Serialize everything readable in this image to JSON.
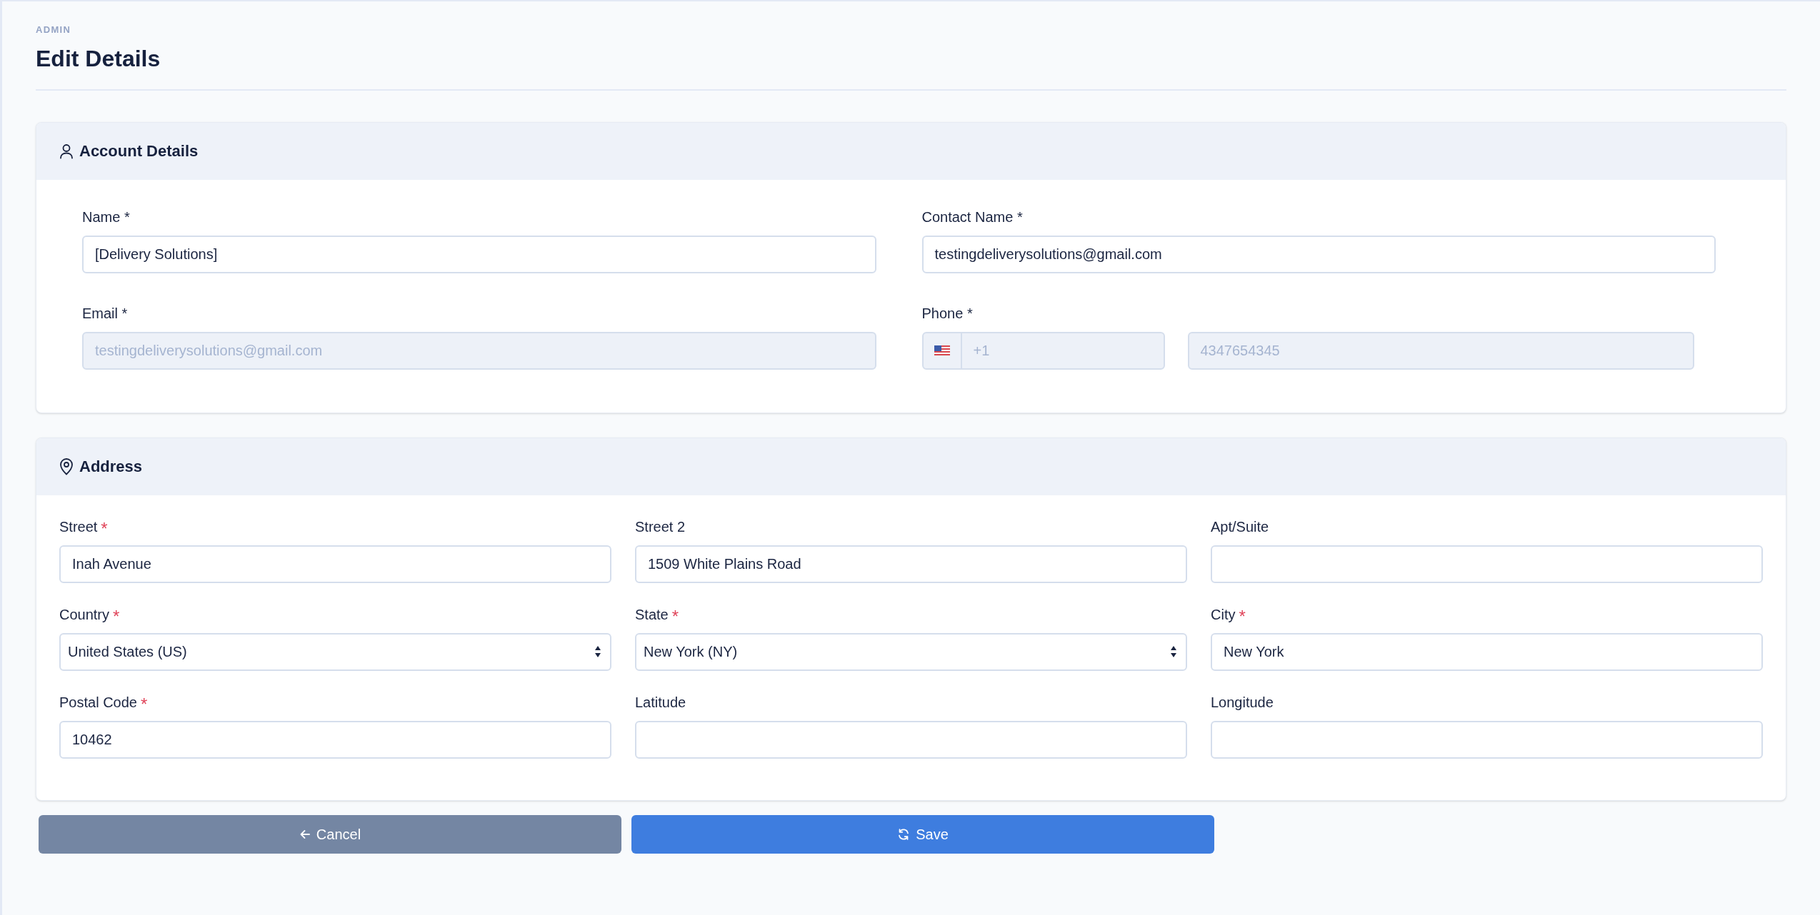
{
  "breadcrumb": "ADMIN",
  "title": "Edit Details",
  "sections": [
    {
      "title": "Account Details",
      "kind": "account",
      "fields": [
        {
          "kind": "text",
          "label": "Name *",
          "value": "[Delivery Solutions]",
          "disabled": false
        },
        {
          "kind": "text",
          "label": "Contact Name *",
          "value": "testingdeliverysolutions@gmail.com",
          "disabled": false
        },
        {
          "kind": "text",
          "label": "Email *",
          "value": "testingdeliverysolutions@gmail.com",
          "disabled": true
        },
        {
          "kind": "phone",
          "label": "Phone *",
          "code": "+1",
          "value": "4347654345",
          "disabled": true
        }
      ]
    },
    {
      "title": "Address",
      "kind": "address",
      "fields": [
        {
          "kind": "text",
          "label": "Street",
          "required_mark": "*",
          "value": "Inah Avenue",
          "disabled": false
        },
        {
          "kind": "text",
          "label": "Street 2",
          "value": "1509 White Plains Road",
          "disabled": false
        },
        {
          "kind": "text",
          "label": "Apt/Suite",
          "disabled": false
        },
        {
          "kind": "select",
          "label": "Country",
          "required_mark": "*",
          "value": "United States (US)",
          "disabled": false
        },
        {
          "kind": "select",
          "label": "State",
          "required_mark": "*",
          "value": "New York (NY)",
          "disabled": false
        },
        {
          "kind": "text",
          "label": "City",
          "required_mark": "*",
          "value": "New York",
          "disabled": false
        },
        {
          "kind": "text",
          "label": "Postal Code",
          "required_mark": "*",
          "value": "10462",
          "disabled": false
        },
        {
          "kind": "text",
          "label": "Latitude",
          "disabled": false
        },
        {
          "kind": "text",
          "label": "Longitude",
          "disabled": false
        }
      ]
    }
  ],
  "buttons": [
    {
      "kind": "cancel",
      "label": "Cancel"
    },
    {
      "kind": "save",
      "label": "Save"
    }
  ]
}
